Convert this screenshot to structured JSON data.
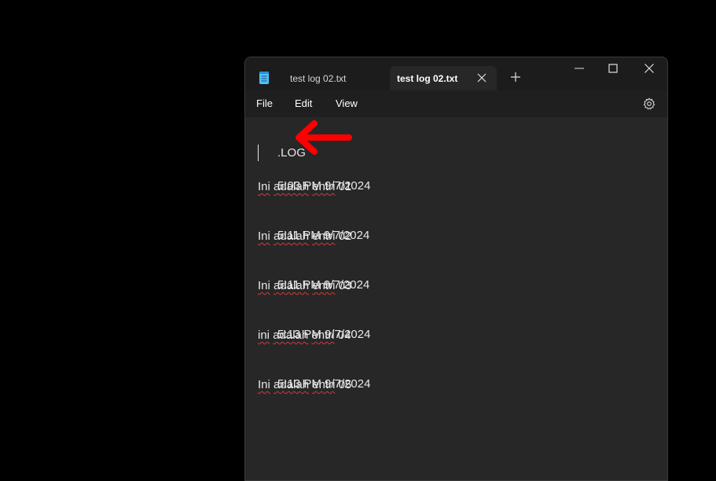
{
  "tabs": [
    {
      "title": "test log 02.txt",
      "active": false
    },
    {
      "title": "test log 02.txt",
      "active": true
    }
  ],
  "menu": {
    "file": "File",
    "edit": "Edit",
    "view": "View"
  },
  "document": {
    "lines": [
      {
        "text": ".LOG",
        "parts": [
          ".LOG"
        ]
      },
      {
        "text": "5:03 PM 9/7/2024",
        "parts": [
          "5:03 PM 9/7/2024"
        ]
      },
      {
        "text": "Ini adalah entri 01",
        "parts": [
          "Ini",
          " ",
          "adalah",
          " ",
          "entri",
          " 01"
        ]
      },
      {
        "text": "5:11 PM 9/7/2024",
        "parts": [
          "5:11 PM 9/7/2024"
        ]
      },
      {
        "text": "Ini adalah entri 02",
        "parts": [
          "Ini",
          " ",
          "adalah",
          " ",
          "entri",
          " 02"
        ]
      },
      {
        "text": "5:11 PM 9/7/2024",
        "parts": [
          "5:11 PM 9/7/2024"
        ]
      },
      {
        "text": "Ini adalah entri 03",
        "parts": [
          "Ini",
          " ",
          "adalah",
          " ",
          "entri",
          " 03"
        ]
      },
      {
        "text": "5:13 PM 9/7/2024",
        "parts": [
          "5:13 PM 9/7/2024"
        ]
      },
      {
        "text": "ini adalah entri 04",
        "parts": [
          "ini",
          " ",
          "adalah",
          " ",
          "entri",
          " 04"
        ]
      },
      {
        "text": "5:13 PM 9/7/2024",
        "parts": [
          "5:13 PM 9/7/2024"
        ]
      },
      {
        "text": "Ini adalah entri 05",
        "parts": [
          "Ini",
          " ",
          "adalah",
          " ",
          "entri",
          " 05"
        ]
      }
    ]
  },
  "icons": {
    "app": "notepad-icon",
    "close_tab": "close-icon",
    "new_tab": "plus-icon",
    "minimize": "minimize-icon",
    "maximize": "maximize-icon",
    "close_window": "close-icon",
    "settings": "gear-icon",
    "annotation": "arrow-left-icon"
  },
  "colors": {
    "background": "#000000",
    "titlebar": "#1c1c1c",
    "editor": "#272727",
    "text": "#e8e8e8",
    "spellcheck": "#d23a3a",
    "annotation_arrow": "#ff0000"
  }
}
